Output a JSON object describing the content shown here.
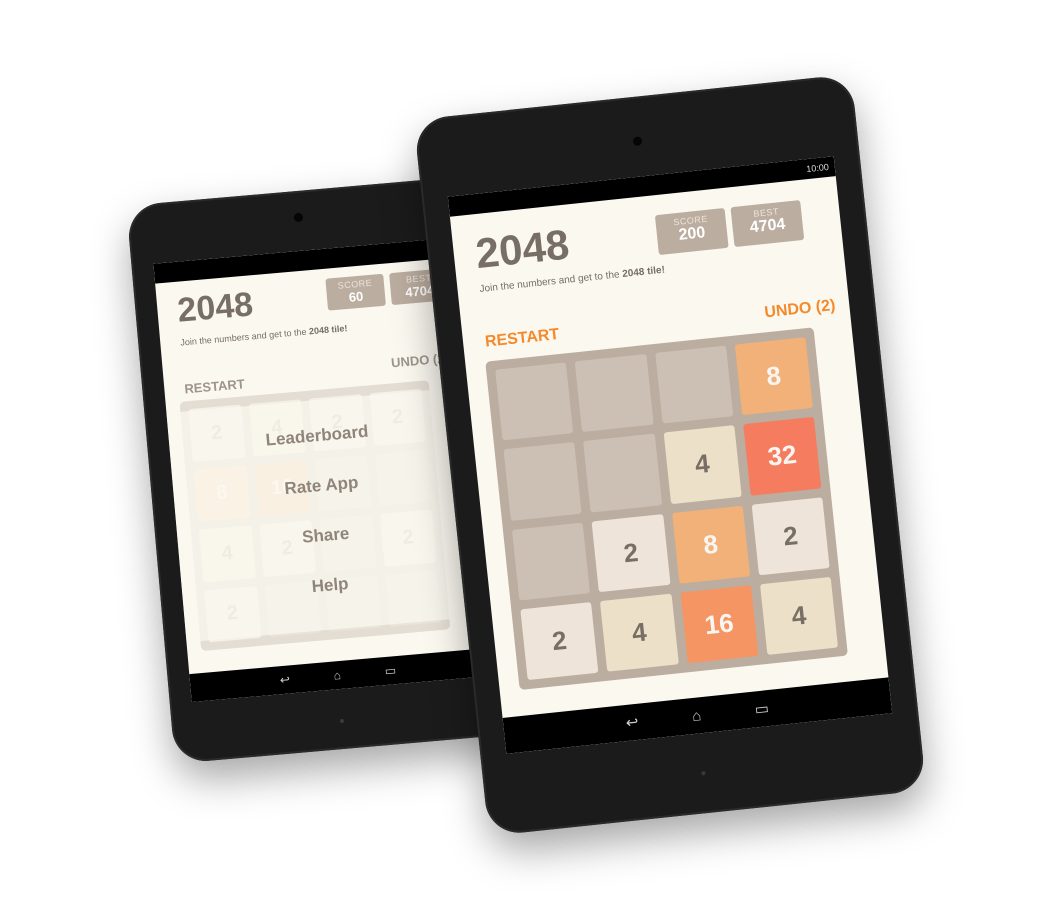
{
  "back_device": {
    "status_time": "",
    "title": "2048",
    "score_label": "SCORE",
    "score_value": "60",
    "best_label": "BEST",
    "best_value": "4704",
    "subtitle_prefix": "Join the numbers and get to the ",
    "subtitle_bold": "2048 tile!",
    "restart_label": "RESTART",
    "undo_label": "UNDO (2)",
    "board": [
      [
        "2",
        "4",
        "2",
        "2"
      ],
      [
        "8",
        "16",
        "",
        ""
      ],
      [
        "4",
        "2",
        "",
        "2"
      ],
      [
        "2",
        "",
        "",
        ""
      ]
    ],
    "menu": [
      "Leaderboard",
      "Rate App",
      "Share",
      "Help"
    ],
    "nav": {
      "back": "↩",
      "home": "⌂",
      "recents": "▭"
    }
  },
  "front_device": {
    "status_time": "10:00",
    "title": "2048",
    "score_label": "SCORE",
    "score_value": "200",
    "best_label": "BEST",
    "best_value": "4704",
    "subtitle_prefix": "Join the numbers and get to the ",
    "subtitle_bold": "2048 tile!",
    "restart_label": "RESTART",
    "undo_label": "UNDO (2)",
    "board": [
      [
        "",
        "",
        "",
        "8"
      ],
      [
        "",
        "",
        "4",
        "32"
      ],
      [
        "",
        "2",
        "8",
        "2"
      ],
      [
        "2",
        "4",
        "16",
        "4"
      ]
    ],
    "nav": {
      "back": "↩",
      "home": "⌂",
      "recents": "▭"
    }
  },
  "colors": {
    "background": "#faf8ef",
    "board": "#bbada0",
    "accent_orange": "#f58a2c",
    "tile_8": "#f2b179",
    "tile_16": "#f59563",
    "tile_32": "#f67c5f"
  }
}
